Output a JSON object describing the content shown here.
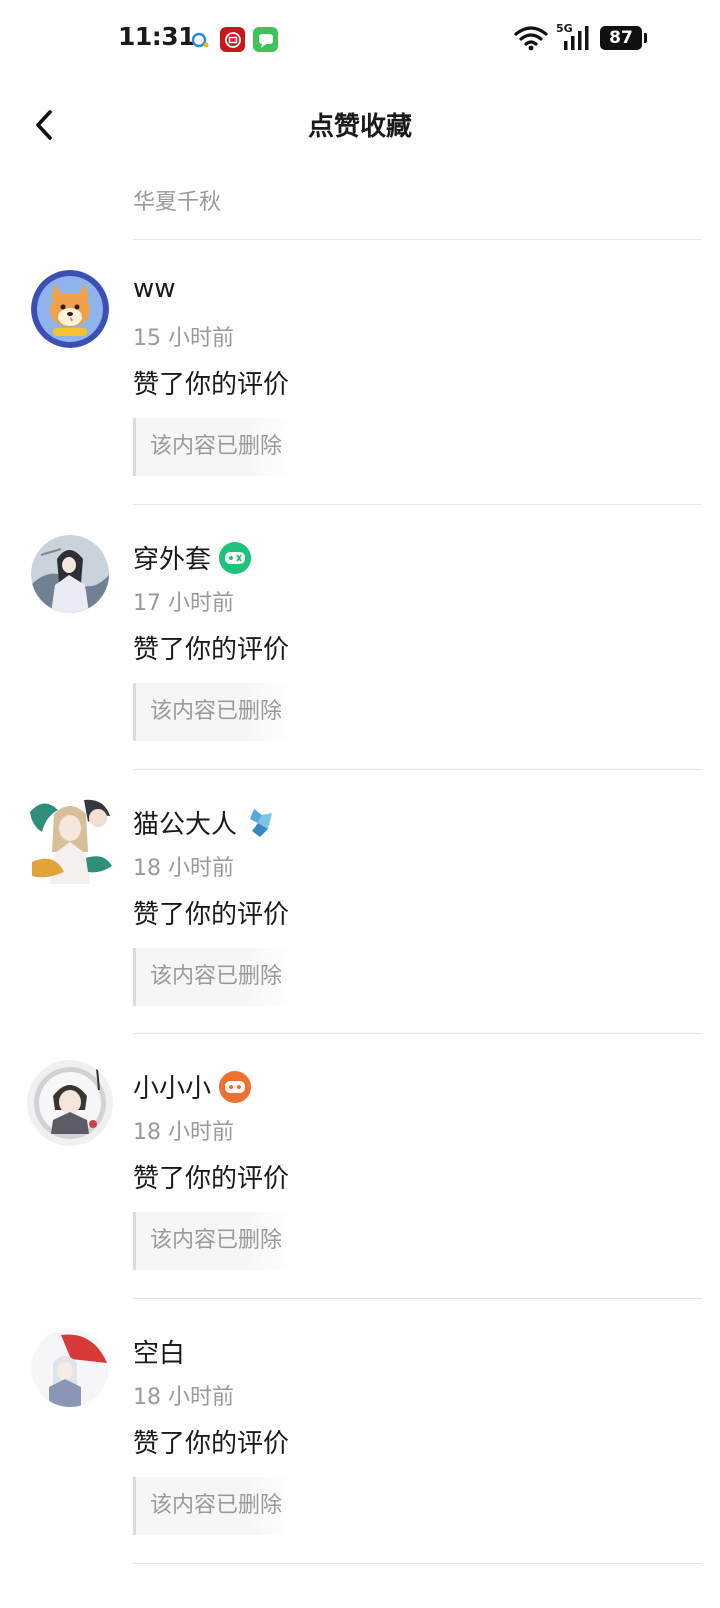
{
  "status_bar": {
    "time": "11:31",
    "network": "5G",
    "battery": "87"
  },
  "header": {
    "title": "点赞收藏"
  },
  "top_partial_text": "华夏千秋",
  "items": [
    {
      "username": "ww",
      "time": "15 小时前",
      "action": "赞了你的评价",
      "content": "该内容已删除",
      "badge": ""
    },
    {
      "username": "穿外套",
      "time": "17 小时前",
      "action": "赞了你的评价",
      "content": "该内容已删除",
      "badge": "green-gamepad-icon"
    },
    {
      "username": "猫公大人",
      "time": "18 小时前",
      "action": "赞了你的评价",
      "content": "该内容已删除",
      "badge": "blue-crystal-icon"
    },
    {
      "username": "小小小",
      "time": "18 小时前",
      "action": "赞了你的评价",
      "content": "该内容已删除",
      "badge": "orange-gamepad-icon"
    },
    {
      "username": "空白",
      "time": "18 小时前",
      "action": "赞了你的评价",
      "content": "该内容已删除",
      "badge": ""
    }
  ]
}
